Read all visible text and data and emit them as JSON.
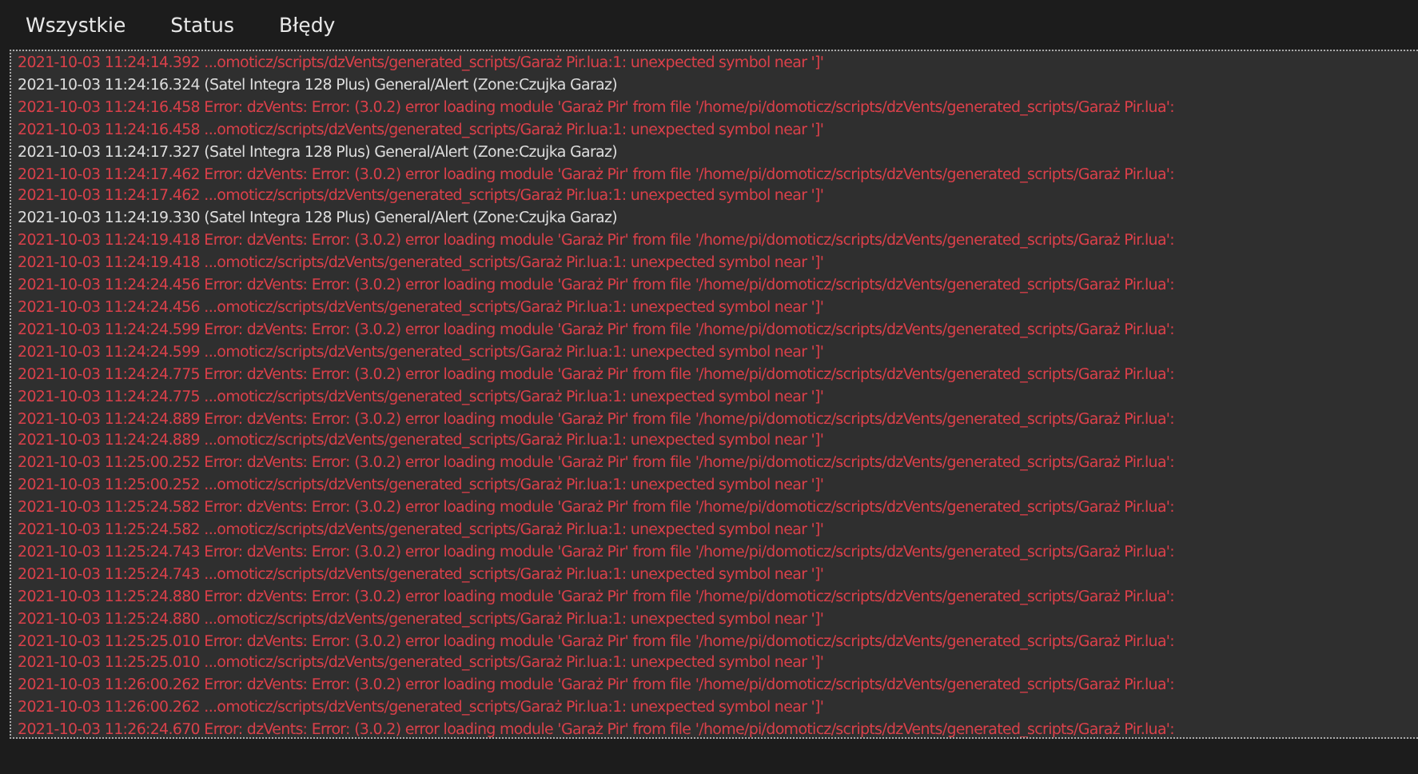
{
  "tabs": [
    {
      "label": "Wszystkie"
    },
    {
      "label": "Status"
    },
    {
      "label": "Błędy"
    }
  ],
  "log": [
    {
      "kind": "error",
      "text": "2021-10-03 11:24:14.392 ...omoticz/scripts/dzVents/generated_scripts/Garaż Pir.lua:1: unexpected symbol near ']'"
    },
    {
      "kind": "info",
      "text": "2021-10-03 11:24:16.324 (Satel Integra 128 Plus) General/Alert (Zone:Czujka Garaz)"
    },
    {
      "kind": "error",
      "text": "2021-10-03 11:24:16.458 Error: dzVents: Error: (3.0.2) error loading module 'Garaż Pir' from file '/home/pi/domoticz/scripts/dzVents/generated_scripts/Garaż Pir.lua':"
    },
    {
      "kind": "error",
      "text": "2021-10-03 11:24:16.458 ...omoticz/scripts/dzVents/generated_scripts/Garaż Pir.lua:1: unexpected symbol near ']'"
    },
    {
      "kind": "info",
      "text": "2021-10-03 11:24:17.327 (Satel Integra 128 Plus) General/Alert (Zone:Czujka Garaz)"
    },
    {
      "kind": "error",
      "text": "2021-10-03 11:24:17.462 Error: dzVents: Error: (3.0.2) error loading module 'Garaż Pir' from file '/home/pi/domoticz/scripts/dzVents/generated_scripts/Garaż Pir.lua':"
    },
    {
      "kind": "error",
      "text": "2021-10-03 11:24:17.462 ...omoticz/scripts/dzVents/generated_scripts/Garaż Pir.lua:1: unexpected symbol near ']'"
    },
    {
      "kind": "info",
      "text": "2021-10-03 11:24:19.330 (Satel Integra 128 Plus) General/Alert (Zone:Czujka Garaz)"
    },
    {
      "kind": "error",
      "text": "2021-10-03 11:24:19.418 Error: dzVents: Error: (3.0.2) error loading module 'Garaż Pir' from file '/home/pi/domoticz/scripts/dzVents/generated_scripts/Garaż Pir.lua':"
    },
    {
      "kind": "error",
      "text": "2021-10-03 11:24:19.418 ...omoticz/scripts/dzVents/generated_scripts/Garaż Pir.lua:1: unexpected symbol near ']'"
    },
    {
      "kind": "error",
      "text": "2021-10-03 11:24:24.456 Error: dzVents: Error: (3.0.2) error loading module 'Garaż Pir' from file '/home/pi/domoticz/scripts/dzVents/generated_scripts/Garaż Pir.lua':"
    },
    {
      "kind": "error",
      "text": "2021-10-03 11:24:24.456 ...omoticz/scripts/dzVents/generated_scripts/Garaż Pir.lua:1: unexpected symbol near ']'"
    },
    {
      "kind": "error",
      "text": "2021-10-03 11:24:24.599 Error: dzVents: Error: (3.0.2) error loading module 'Garaż Pir' from file '/home/pi/domoticz/scripts/dzVents/generated_scripts/Garaż Pir.lua':"
    },
    {
      "kind": "error",
      "text": "2021-10-03 11:24:24.599 ...omoticz/scripts/dzVents/generated_scripts/Garaż Pir.lua:1: unexpected symbol near ']'"
    },
    {
      "kind": "error",
      "text": "2021-10-03 11:24:24.775 Error: dzVents: Error: (3.0.2) error loading module 'Garaż Pir' from file '/home/pi/domoticz/scripts/dzVents/generated_scripts/Garaż Pir.lua':"
    },
    {
      "kind": "error",
      "text": "2021-10-03 11:24:24.775 ...omoticz/scripts/dzVents/generated_scripts/Garaż Pir.lua:1: unexpected symbol near ']'"
    },
    {
      "kind": "error",
      "text": "2021-10-03 11:24:24.889 Error: dzVents: Error: (3.0.2) error loading module 'Garaż Pir' from file '/home/pi/domoticz/scripts/dzVents/generated_scripts/Garaż Pir.lua':"
    },
    {
      "kind": "error",
      "text": "2021-10-03 11:24:24.889 ...omoticz/scripts/dzVents/generated_scripts/Garaż Pir.lua:1: unexpected symbol near ']'"
    },
    {
      "kind": "error",
      "text": "2021-10-03 11:25:00.252 Error: dzVents: Error: (3.0.2) error loading module 'Garaż Pir' from file '/home/pi/domoticz/scripts/dzVents/generated_scripts/Garaż Pir.lua':"
    },
    {
      "kind": "error",
      "text": "2021-10-03 11:25:00.252 ...omoticz/scripts/dzVents/generated_scripts/Garaż Pir.lua:1: unexpected symbol near ']'"
    },
    {
      "kind": "error",
      "text": "2021-10-03 11:25:24.582 Error: dzVents: Error: (3.0.2) error loading module 'Garaż Pir' from file '/home/pi/domoticz/scripts/dzVents/generated_scripts/Garaż Pir.lua':"
    },
    {
      "kind": "error",
      "text": "2021-10-03 11:25:24.582 ...omoticz/scripts/dzVents/generated_scripts/Garaż Pir.lua:1: unexpected symbol near ']'"
    },
    {
      "kind": "error",
      "text": "2021-10-03 11:25:24.743 Error: dzVents: Error: (3.0.2) error loading module 'Garaż Pir' from file '/home/pi/domoticz/scripts/dzVents/generated_scripts/Garaż Pir.lua':"
    },
    {
      "kind": "error",
      "text": "2021-10-03 11:25:24.743 ...omoticz/scripts/dzVents/generated_scripts/Garaż Pir.lua:1: unexpected symbol near ']'"
    },
    {
      "kind": "error",
      "text": "2021-10-03 11:25:24.880 Error: dzVents: Error: (3.0.2) error loading module 'Garaż Pir' from file '/home/pi/domoticz/scripts/dzVents/generated_scripts/Garaż Pir.lua':"
    },
    {
      "kind": "error",
      "text": "2021-10-03 11:25:24.880 ...omoticz/scripts/dzVents/generated_scripts/Garaż Pir.lua:1: unexpected symbol near ']'"
    },
    {
      "kind": "error",
      "text": "2021-10-03 11:25:25.010 Error: dzVents: Error: (3.0.2) error loading module 'Garaż Pir' from file '/home/pi/domoticz/scripts/dzVents/generated_scripts/Garaż Pir.lua':"
    },
    {
      "kind": "error",
      "text": "2021-10-03 11:25:25.010 ...omoticz/scripts/dzVents/generated_scripts/Garaż Pir.lua:1: unexpected symbol near ']'"
    },
    {
      "kind": "error",
      "text": "2021-10-03 11:26:00.262 Error: dzVents: Error: (3.0.2) error loading module 'Garaż Pir' from file '/home/pi/domoticz/scripts/dzVents/generated_scripts/Garaż Pir.lua':"
    },
    {
      "kind": "error",
      "text": "2021-10-03 11:26:00.262 ...omoticz/scripts/dzVents/generated_scripts/Garaż Pir.lua:1: unexpected symbol near ']'"
    },
    {
      "kind": "error",
      "text": "2021-10-03 11:26:24.670 Error: dzVents: Error: (3.0.2) error loading module 'Garaż Pir' from file '/home/pi/domoticz/scripts/dzVents/generated_scripts/Garaż Pir.lua':"
    }
  ]
}
